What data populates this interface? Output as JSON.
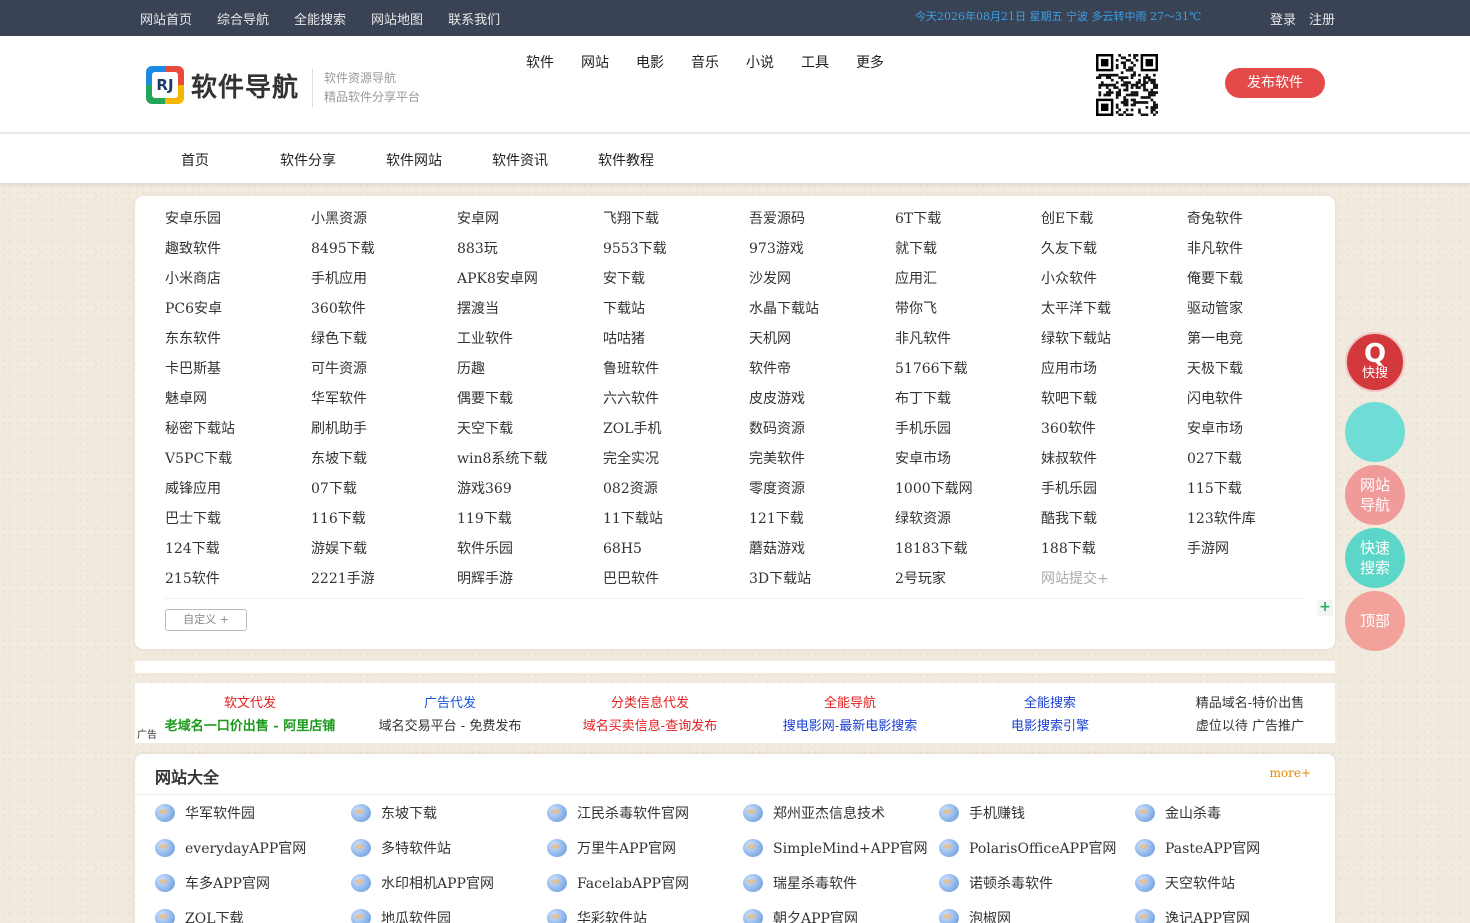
{
  "topbar": {
    "nav": [
      "网站首页",
      "综合导航",
      "全能搜索",
      "网站地图",
      "联系我们"
    ],
    "weather": "今天2026年08月21日 星期五 宁波 多云转中雨 27～31℃",
    "login": "登录",
    "register": "注册"
  },
  "header": {
    "logo_mark": "RJ",
    "logo_text": "软件导航",
    "slogan1": "软件资源导航",
    "slogan2": "精品软件分享平台",
    "categories": [
      "软件",
      "网站",
      "电影",
      "音乐",
      "小说",
      "工具",
      "更多"
    ],
    "publish_label": "发布软件"
  },
  "mainnav": [
    "首页",
    "软件分享",
    "软件网站",
    "软件资讯",
    "软件教程"
  ],
  "links": [
    "安卓乐园",
    "小黑资源",
    "安卓网",
    "飞翔下载",
    "吾爱源码",
    "6T下载",
    "创E下载",
    "奇兔软件",
    "趣致软件",
    "8495下载",
    "883玩",
    "9553下载",
    "973游戏",
    "就下载",
    "久友下载",
    "非凡软件",
    "小米商店",
    "手机应用",
    "APK8安卓网",
    "安下载",
    "沙发网",
    "应用汇",
    "小众软件",
    "俺要下载",
    "PC6安卓",
    "360软件",
    "摆渡当",
    "下载站",
    "水晶下载站",
    "带你飞",
    "太平洋下载",
    "驱动管家",
    "东东软件",
    "绿色下载",
    "工业软件",
    "咕咕猪",
    "天机网",
    "非凡软件",
    "绿软下载站",
    "第一电竞",
    "卡巴斯基",
    "可牛资源",
    "历趣",
    "鲁班软件",
    "软件帝",
    "51766下载",
    "应用市场",
    "天极下载",
    "魅卓网",
    "华军软件",
    "偶要下载",
    "六六软件",
    "皮皮游戏",
    "布丁下载",
    "软吧下载",
    "闪电软件",
    "秘密下载站",
    "刷机助手",
    "天空下载",
    "ZOL手机",
    "数码资源",
    "手机乐园",
    "360软件",
    "安卓市场",
    "V5PC下载",
    "东坡下载",
    "win8系统下载",
    "完全实况",
    "完美软件",
    "安卓市场",
    "妹叔软件",
    "027下载",
    "威锋应用",
    "07下载",
    "游戏369",
    "082资源",
    "零度资源",
    "1000下载网",
    "手机乐园",
    "115下载",
    "巴士下载",
    "116下载",
    "119下载",
    "11下载站",
    "121下载",
    "绿软资源",
    "酷我下载",
    "123软件库",
    "124下载",
    "游娱下载",
    "软件乐园",
    "68H5",
    "蘑菇游戏",
    "18183下载",
    "188下载",
    "手游网",
    "215软件",
    "2221手游",
    "明辉手游",
    "巴巴软件",
    "3D下载站",
    "2号玩家",
    "网站提交+"
  ],
  "custom_label": "自定义 +",
  "plus_label": "+",
  "ads": {
    "tag": "广告",
    "cols": [
      {
        "l1": "软文代发",
        "l1c": "#e02020",
        "l2": "老域名一口价出售 - 阿里店铺",
        "l2c": "#1a9a1a"
      },
      {
        "l1": "广告代发",
        "l1c": "#1a55d8",
        "l2": "域名交易平台 - 免费发布",
        "l2c": "#333333"
      },
      {
        "l1": "分类信息代发",
        "l1c": "#e02020",
        "l2": "域名买卖信息-查询发布",
        "l2c": "#e02020"
      },
      {
        "l1": "全能导航",
        "l1c": "#e02020",
        "l2": "搜电影网-最新电影搜索",
        "l2c": "#1a3fd0"
      },
      {
        "l1": "全能搜索",
        "l1c": "#1a3fd0",
        "l2": "电影搜索引擎",
        "l2c": "#1a3fd0"
      },
      {
        "l1": "精品域名-特价出售",
        "l1c": "#333333",
        "l2": "虚位以待 广告推广",
        "l2c": "#333333"
      }
    ]
  },
  "sites": {
    "title": "网站大全",
    "more": "more+",
    "items": [
      "华军软件园",
      "东坡下载",
      "江民杀毒软件官网",
      "郑州亚杰信息技术",
      "手机赚钱",
      "金山杀毒",
      "everydayAPP官网",
      "多特软件站",
      "万里牛APP官网",
      "SimpleMind+APP官网",
      "PolarisOfficeAPP官网",
      "PasteAPP官网",
      "车多APP官网",
      "水印相机APP官网",
      "FacelabAPP官网",
      "瑞星杀毒软件",
      "诺顿杀毒软件",
      "天空软件站",
      "ZOL下载",
      "地瓜软件园",
      "华彩软件站",
      "朝夕APP官网",
      "泡椒网",
      "逸记APP官网"
    ]
  },
  "float": {
    "quick_icon": "Q",
    "quick_label": "快搜",
    "nav_label1": "网站",
    "nav_label2": "导航",
    "search_label1": "快速",
    "search_label2": "搜索",
    "top_label": "顶部"
  }
}
